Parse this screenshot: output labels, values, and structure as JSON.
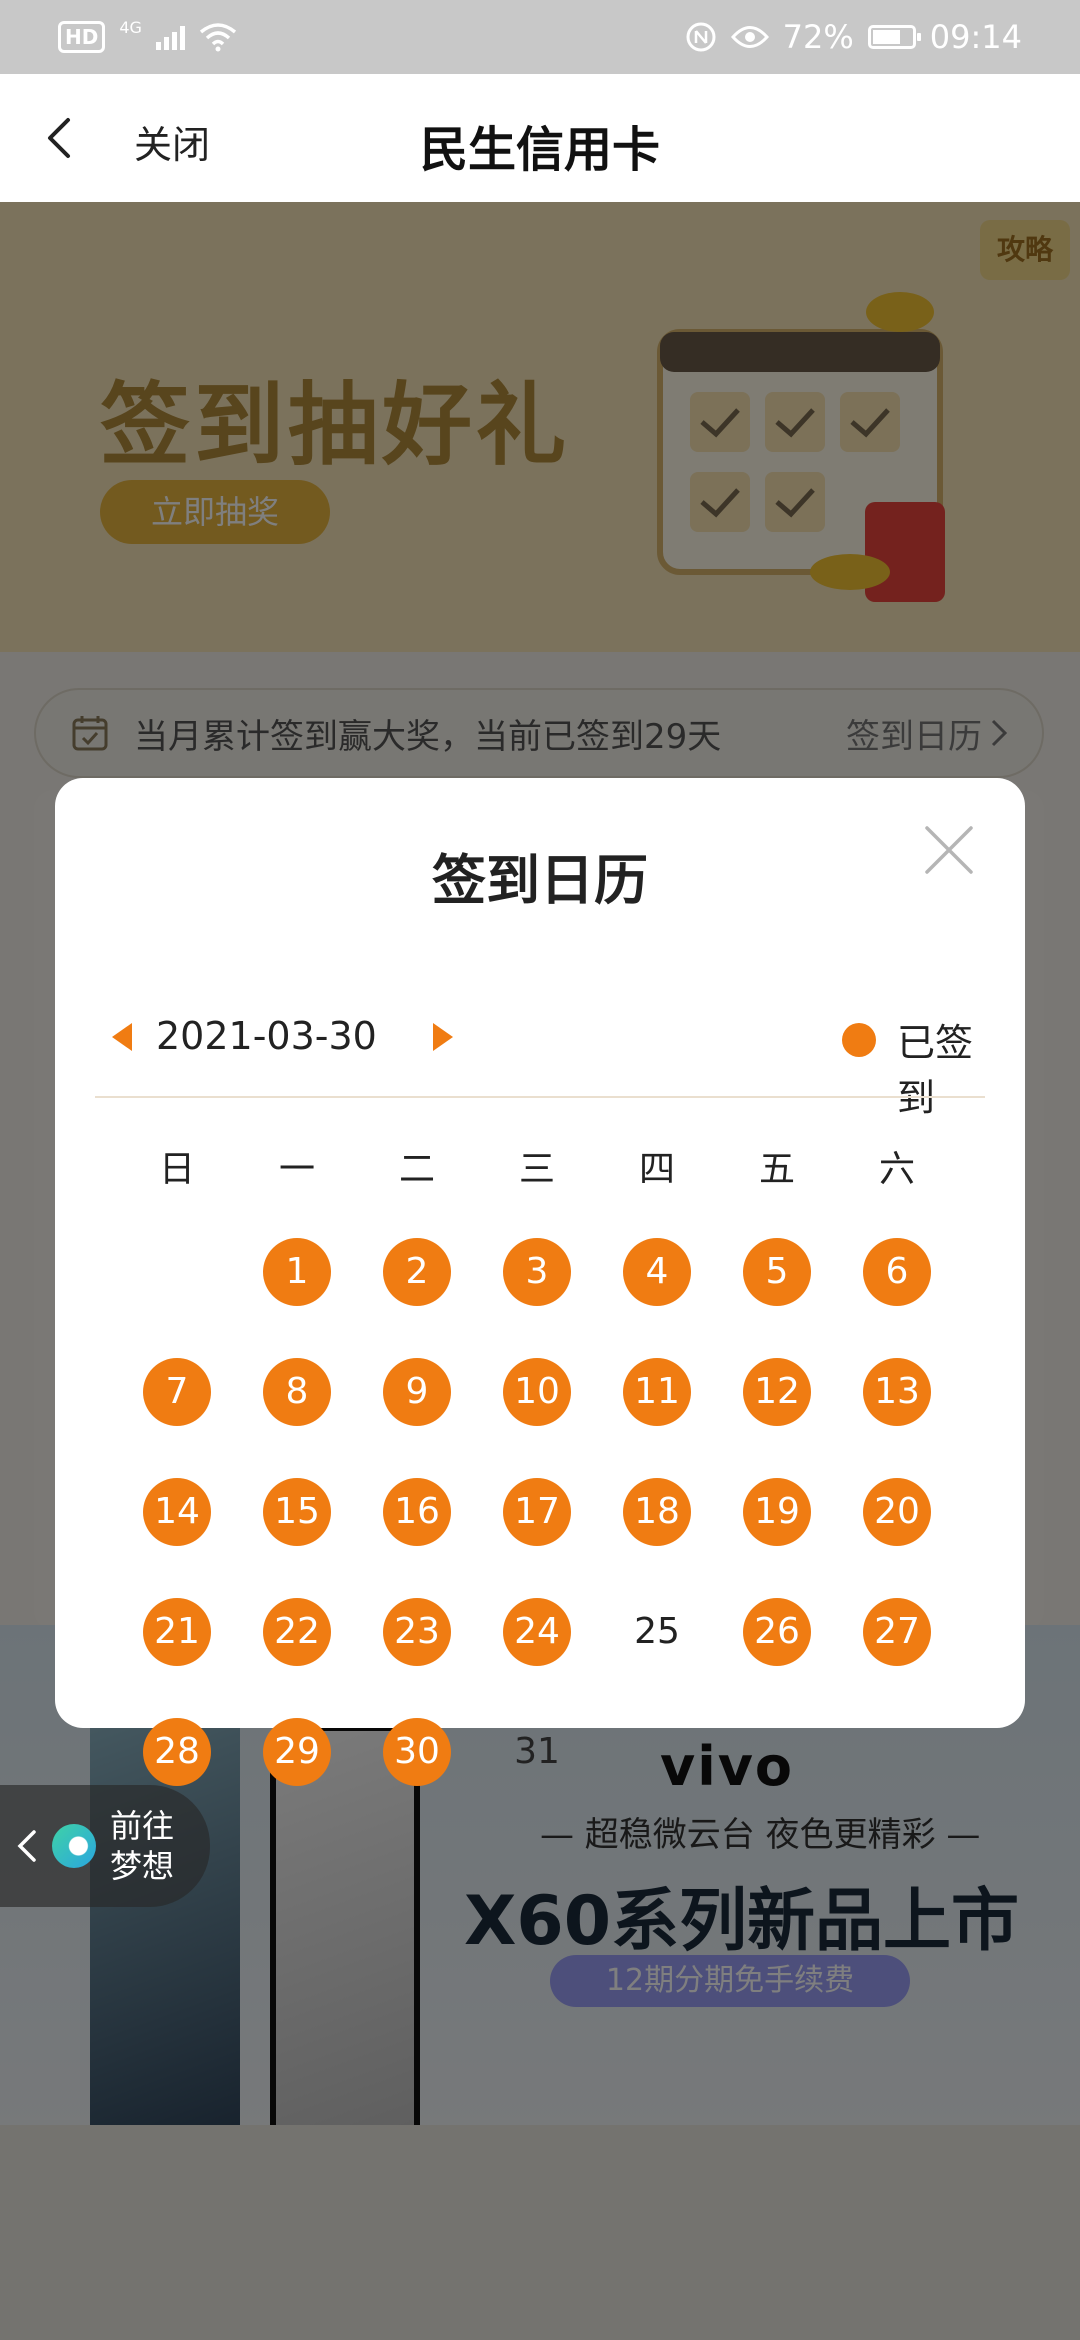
{
  "status_bar": {
    "hd": "HD",
    "network": "4G",
    "battery_percent": "72%",
    "battery_level": 0.72,
    "time": "09:14"
  },
  "nav": {
    "back_icon": "chevron-left-icon",
    "close_label": "关闭",
    "title": "民生信用卡"
  },
  "banner": {
    "title": "签到抽好礼",
    "button_label": "立即抽奖",
    "strategy_label": "攻略"
  },
  "checkin_strip": {
    "text": "当月累计签到赢大奖，当前已签到29天",
    "link_label": "签到日历"
  },
  "ad": {
    "brand": "vivo",
    "slogan": "— 超稳微云台 夜色更精彩 —",
    "headline": "X60系列新品上市",
    "subline": "12期分期免手续费"
  },
  "floating_button": {
    "line1": "前往",
    "line2": "梦想"
  },
  "modal": {
    "title": "签到日历",
    "date": "2021-03-30",
    "legend_label": "已签到",
    "accent_color": "#f07c12",
    "weekdays": [
      "日",
      "一",
      "二",
      "三",
      "四",
      "五",
      "六"
    ],
    "first_weekday_index": 1,
    "days": [
      {
        "day": "1",
        "checked": true
      },
      {
        "day": "2",
        "checked": true
      },
      {
        "day": "3",
        "checked": true
      },
      {
        "day": "4",
        "checked": true
      },
      {
        "day": "5",
        "checked": true
      },
      {
        "day": "6",
        "checked": true
      },
      {
        "day": "7",
        "checked": true
      },
      {
        "day": "8",
        "checked": true
      },
      {
        "day": "9",
        "checked": true
      },
      {
        "day": "10",
        "checked": true
      },
      {
        "day": "11",
        "checked": true
      },
      {
        "day": "12",
        "checked": true
      },
      {
        "day": "13",
        "checked": true
      },
      {
        "day": "14",
        "checked": true
      },
      {
        "day": "15",
        "checked": true
      },
      {
        "day": "16",
        "checked": true
      },
      {
        "day": "17",
        "checked": true
      },
      {
        "day": "18",
        "checked": true
      },
      {
        "day": "19",
        "checked": true
      },
      {
        "day": "20",
        "checked": true
      },
      {
        "day": "21",
        "checked": true
      },
      {
        "day": "22",
        "checked": true
      },
      {
        "day": "23",
        "checked": true
      },
      {
        "day": "24",
        "checked": true
      },
      {
        "day": "25",
        "checked": false
      },
      {
        "day": "26",
        "checked": true
      },
      {
        "day": "27",
        "checked": true
      },
      {
        "day": "28",
        "checked": true
      },
      {
        "day": "29",
        "checked": true
      },
      {
        "day": "30",
        "checked": true
      },
      {
        "day": "31",
        "checked": false
      }
    ]
  }
}
